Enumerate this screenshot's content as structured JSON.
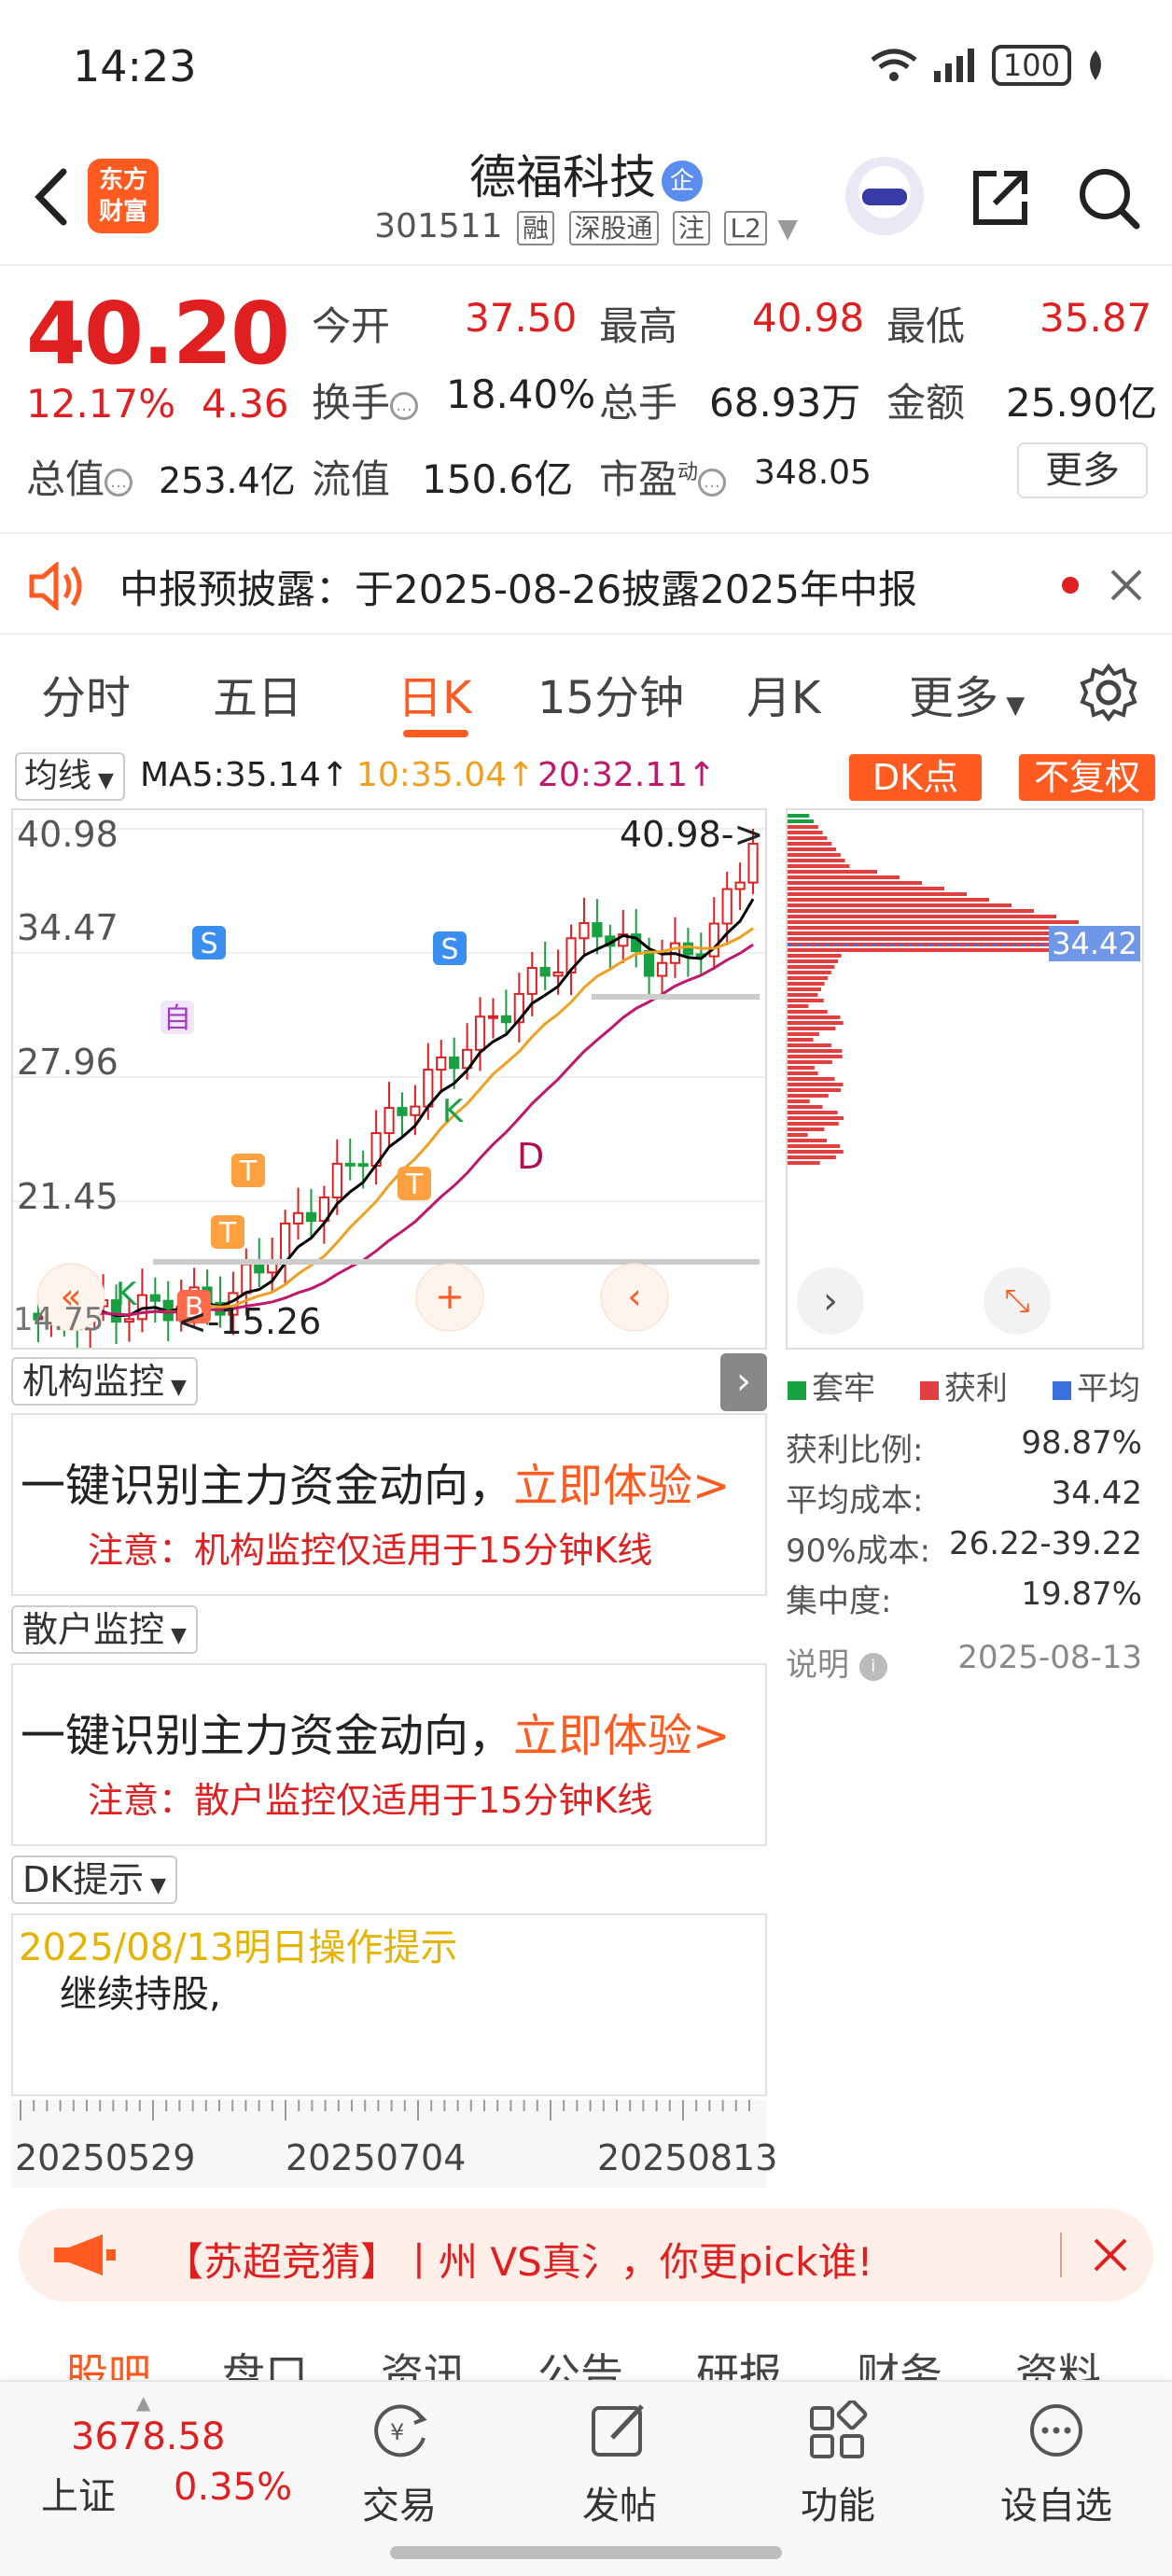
{
  "status": {
    "time": "14:23",
    "battery": "100"
  },
  "header": {
    "logo": "东方\n财富",
    "name": "德福科技",
    "name_badge": "企",
    "code": "301511",
    "tags": [
      "融",
      "深股通",
      "注",
      "L2"
    ]
  },
  "quote": {
    "price": "40.20",
    "pct": "12.17%",
    "chg": "4.36",
    "open_label": "今开",
    "open": "37.50",
    "high_label": "最高",
    "high": "40.98",
    "low_label": "最低",
    "low": "35.87",
    "turnover_label": "换手",
    "turnover": "18.40%",
    "volume_label": "总手",
    "volume": "68.93万",
    "amount_label": "金额",
    "amount": "25.90亿",
    "mcap_label": "总值",
    "mcap": "253.4亿",
    "float_label": "流值",
    "float": "150.6亿",
    "pe_label": "市盈",
    "pe_sup": "动",
    "pe": "348.05",
    "more": "更多"
  },
  "notice": {
    "text": "中报预披露：于2025-08-26披露2025年中报"
  },
  "tabs": [
    "分时",
    "五日",
    "日K",
    "15分钟",
    "月K",
    "更多"
  ],
  "chart_head": {
    "ma_button": "均线",
    "ma5": "MA5:35.14↑",
    "ma10": "10:35.04↑",
    "ma20": "20:32.11↑",
    "dk_button": "DK点",
    "adjust_button": "不复权"
  },
  "chart_labels": {
    "y": [
      "40.98",
      "34.47",
      "27.96",
      "21.45"
    ],
    "high_mark": "40.98->",
    "low_mark": "<-15.26",
    "left_partial": "14.75",
    "chip_avg": "34.42",
    "sig_s": "S",
    "sig_k": "K",
    "sig_d": "D",
    "sig_b": "B",
    "sig_t": "T",
    "sig_zi": "自"
  },
  "colors": {
    "accent": "#ff5a1f",
    "up": "#e02020",
    "down": "#19a040",
    "ma5": "#000000",
    "ma10": "#f0a020",
    "ma20": "#c0186a"
  },
  "inst": {
    "head": "机构监控",
    "main": "一键识别主力资金动向，",
    "cta": "立即体验>",
    "note": "注意：机构监控仅适用于15分钟K线"
  },
  "retail": {
    "head": "散户监控",
    "main": "一键识别主力资金动向，",
    "cta": "立即体验>",
    "note": "注意：散户监控仅适用于15分钟K线"
  },
  "chips": {
    "legend": [
      "套牢",
      "获利",
      "平均"
    ],
    "rows": [
      {
        "k": "获利比例:",
        "v": "98.87%"
      },
      {
        "k": "平均成本:",
        "v": "34.42"
      },
      {
        "k": "90%成本:",
        "v": "26.22-39.22"
      },
      {
        "k": "集中度:",
        "v": "19.87%"
      }
    ],
    "note_label": "说明",
    "date": "2025-08-13"
  },
  "dk": {
    "head": "DK提示",
    "date": "2025/08/13明日操作提示",
    "text": "继续持股,"
  },
  "dates": [
    "20250529",
    "20250704",
    "20250813"
  ],
  "banner": {
    "text": "【苏超竞猜】丨州 VS真氵，你更pick谁!"
  },
  "subtabs": [
    "股吧",
    "盘口",
    "资讯",
    "公告",
    "研报",
    "财务",
    "资料"
  ],
  "bottom": {
    "index_value": "3678.58",
    "index_name": "上证",
    "index_pct": "0.35%",
    "nav": [
      "交易",
      "发帖",
      "功能",
      "设自选"
    ]
  },
  "chart_data": {
    "type": "candlestick",
    "x_ticks": [
      "20250529",
      "20250704",
      "20250813"
    ],
    "ylim": [
      14.75,
      40.98
    ],
    "y_ticks": [
      40.98,
      34.47,
      27.96,
      21.45
    ],
    "ma_latest": {
      "MA5": 35.14,
      "MA10": 35.04,
      "MA20": 32.11
    },
    "period_high": 40.98,
    "period_low": 15.26,
    "last_close": 40.2
  }
}
